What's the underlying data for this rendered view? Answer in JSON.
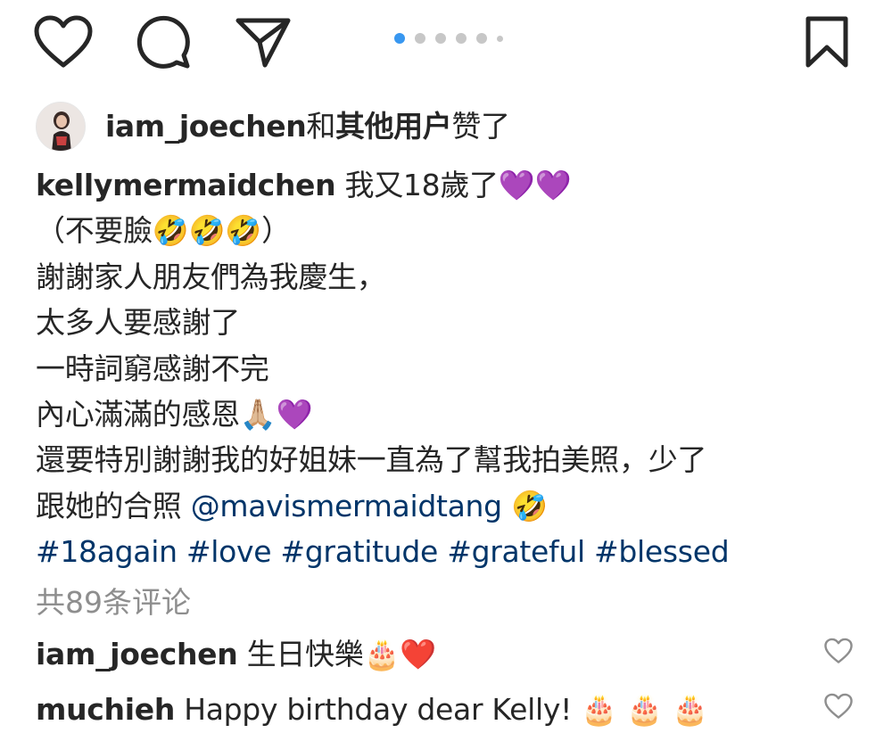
{
  "actions": {
    "like_icon": "heart-outline-icon",
    "comment_icon": "comment-bubble-icon",
    "share_icon": "paper-plane-icon",
    "save_icon": "bookmark-icon"
  },
  "carousel": {
    "count": 6,
    "active_index": 0
  },
  "likes": {
    "user": "iam_joechen",
    "connector": "和",
    "others": "其他用户",
    "suffix": "赞了"
  },
  "caption": {
    "author": "kellymermaidchen",
    "first_line": " 我又18歲了💜💜",
    "lines": [
      "（不要臉🤣🤣🤣）",
      "謝謝家人朋友們為我慶生，",
      "太多人要感謝了",
      "一時詞窮感謝不完",
      "內心滿滿的感恩🙏🏼💜",
      "還要特別謝謝我的好姐妹一直為了幫我拍美照，少了"
    ],
    "last_line_text": "跟她的合照 ",
    "mention": "@mavismermaidtang",
    "last_line_emoji": " 🤣",
    "hashtags": "#18again #love #gratitude #grateful #blessed"
  },
  "comments_count": "共89条评论",
  "comments": [
    {
      "user": "iam_joechen",
      "text": " 生日快樂🎂❤️"
    },
    {
      "user": "muchieh",
      "text": " Happy birthday dear Kelly! 🎂 🎂 🎂"
    }
  ],
  "colors": {
    "text": "#262626",
    "link": "#003569",
    "muted": "#8e8e8e",
    "dot_active": "#3897f0",
    "dot_inactive": "#c7c7c7"
  }
}
